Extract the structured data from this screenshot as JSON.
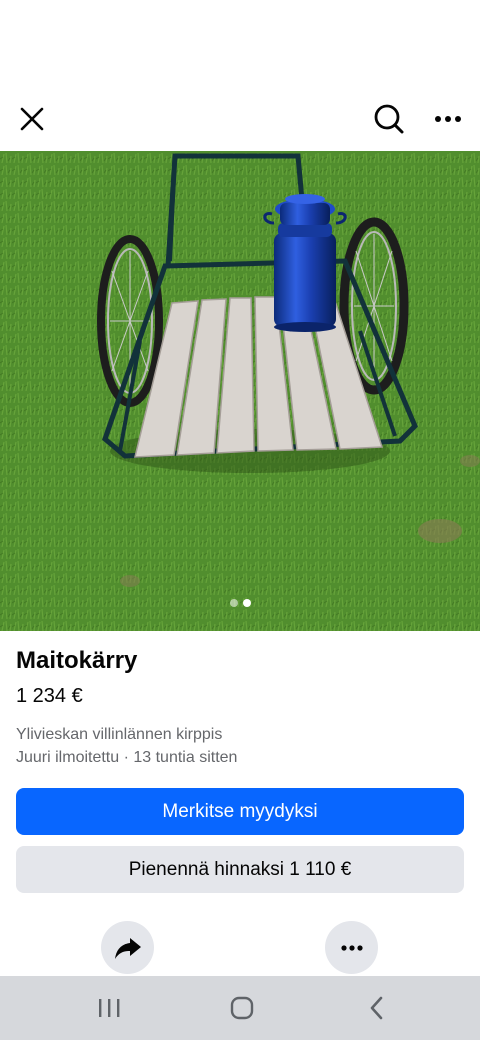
{
  "topbar": {
    "close_icon": "close-icon",
    "search_icon": "search-icon",
    "more_icon": "more-horizontal-icon"
  },
  "photo": {
    "description_icon": "listing-photo",
    "page_count": 2,
    "active_page": 2
  },
  "listing": {
    "title": "Maitokärry",
    "price": "1 234 €",
    "location": "Ylivieskan villinlännen kirppis",
    "posted": "Juuri ilmoitettu · 13 tuntia sitten"
  },
  "actions": {
    "mark_sold": "Merkitse myydyksi",
    "reduce_price": "Pienennä hinnaksi 1 110 €",
    "share_icon": "share-arrow-icon",
    "options_icon": "more-horizontal-icon"
  },
  "colors": {
    "primary": "#0866ff",
    "secondary_bg": "#e4e6eb",
    "meta_text": "#65676b",
    "navbar_bg": "#d6d8dc"
  },
  "system_nav": {
    "recent_icon": "recent-apps-icon",
    "home_icon": "home-icon",
    "back_icon": "back-icon"
  }
}
